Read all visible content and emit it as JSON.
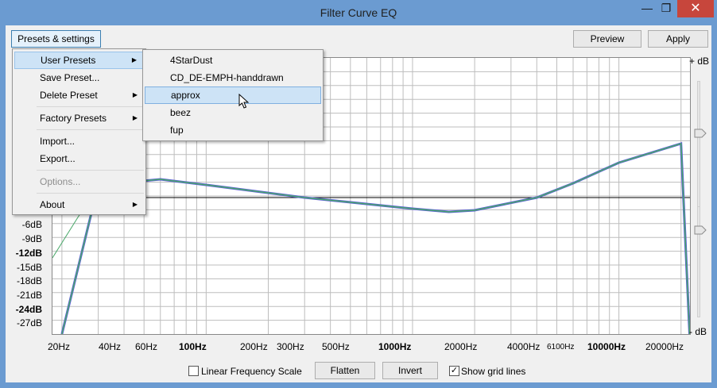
{
  "window": {
    "title": "Filter Curve EQ",
    "min_glyph": "—",
    "max_glyph": "❐",
    "close_glyph": "✕"
  },
  "toolbar": {
    "presets_label": "Presets & settings",
    "preview_label": "Preview",
    "apply_label": "Apply"
  },
  "menu": {
    "items": [
      {
        "label": "User Presets",
        "submenu": true,
        "highlighted": true
      },
      {
        "label": "Save Preset...",
        "submenu": false
      },
      {
        "label": "Delete Preset",
        "submenu": true
      },
      {
        "label": "Factory Presets",
        "submenu": true
      },
      {
        "label": "Import...",
        "submenu": false
      },
      {
        "label": "Export...",
        "submenu": false
      },
      {
        "label": "Options...",
        "submenu": false,
        "disabled": true
      },
      {
        "label": "About",
        "submenu": true
      }
    ],
    "arrow_glyph": "▶"
  },
  "submenu": {
    "items": [
      "4StarDust",
      "CD_DE-EMPH-handdrawn",
      "approx",
      "beez",
      "fup"
    ],
    "highlighted": "approx"
  },
  "graph": {
    "y_labels": [
      "-6dB",
      "-9dB",
      "-12dB",
      "-15dB",
      "-18dB",
      "-21dB",
      "-24dB",
      "-27dB"
    ],
    "x_labels": [
      "20Hz",
      "40Hz",
      "60Hz",
      "100Hz",
      "200Hz",
      "300Hz",
      "500Hz",
      "1000Hz",
      "2000Hz",
      "4000Hz",
      "6100Hz",
      "10000Hz",
      "20000Hz"
    ],
    "right_top_label": "+ dB",
    "right_bottom_label": "- dB",
    "curve_colors": {
      "smooth": "#5a5adb",
      "line": "#4aa86a",
      "grid": "#bdbdbd",
      "zero": "#000000"
    }
  },
  "controls": {
    "linear_label": "Linear Frequency Scale",
    "flatten_label": "Flatten",
    "invert_label": "Invert",
    "grid_label": "Show grid lines",
    "check_glyph": "✓",
    "linear_checked": false,
    "grid_checked": true
  }
}
